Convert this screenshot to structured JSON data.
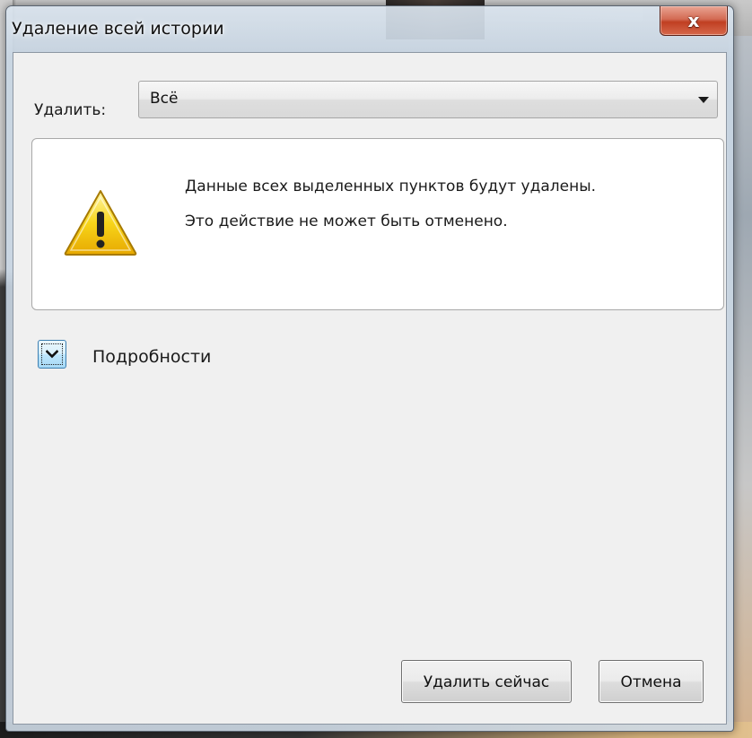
{
  "window": {
    "title": "Удаление всей истории",
    "close_glyph": "x"
  },
  "range": {
    "label": "Удалить:",
    "selected": "Всё"
  },
  "warning": {
    "line1": "Данные всех выделенных пунктов будут удалены.",
    "line2": "Это действие не может быть отменено.",
    "icon": "warning-icon",
    "icon_color": "#f5c400"
  },
  "details": {
    "label": "Подробности",
    "toggle_icon": "chevron-down-icon"
  },
  "buttons": {
    "delete_now": "Удалить сейчас",
    "cancel": "Отмена"
  },
  "colors": {
    "close_button": "#c9442a",
    "toggle_accent": "#3c7fb1",
    "client_background": "#f0f0f0"
  }
}
